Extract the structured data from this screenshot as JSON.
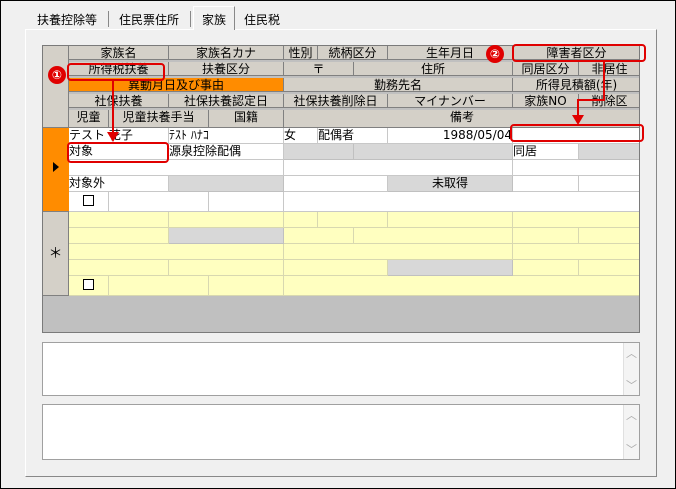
{
  "tabs": [
    "扶養控除等",
    "住民票住所",
    "家族",
    "住民税"
  ],
  "header": {
    "row1": [
      "家族名",
      "家族名カナ",
      "性別",
      "続柄区分",
      "生年月日",
      "障害者区分"
    ],
    "row2": [
      "所得税扶養",
      "扶養区分",
      "〒",
      "住所",
      "同居区分",
      "非居住"
    ],
    "row3": [
      "異動月日及び事由",
      "勤務先名",
      "所得見積額(年)"
    ],
    "row4": [
      "社保扶養",
      "社保扶養認定日",
      "社保扶養削除日",
      "マイナンバー",
      "家族NO",
      "削除区"
    ],
    "row5": [
      "児童",
      "児童扶養手当",
      "国籍",
      "備考"
    ]
  },
  "record": {
    "name": "テスト 花子",
    "kana": "ﾃｽﾄ ﾊﾅｺ",
    "gender": "女",
    "relation": "配偶者",
    "birth": "1988/05/04",
    "tax_dep": "対象",
    "dep_type": "源泉控除配偶",
    "living": "同居",
    "social": "対象外",
    "mynumber": "未取得"
  },
  "new_row_marker": "＊",
  "callouts": {
    "one": "①",
    "two": "②"
  },
  "scroll": {
    "up": "︿",
    "down": "﹀"
  }
}
